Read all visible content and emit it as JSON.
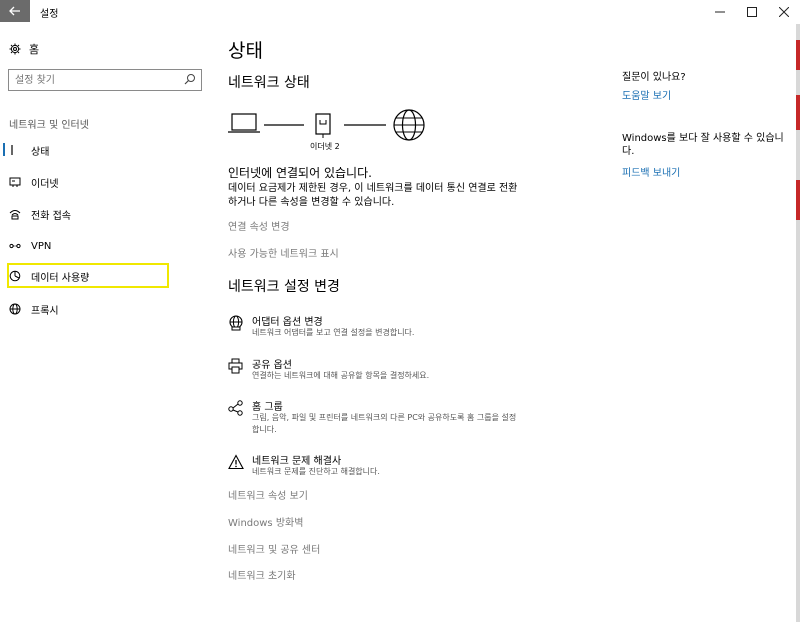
{
  "window": {
    "title": "설정",
    "back_icon": "back-arrow-icon",
    "minimize_glyph": "—",
    "maximize_glyph": "☐",
    "close_glyph": "✕"
  },
  "sidebar": {
    "home_label": "홈",
    "search_placeholder": "설정 찾기",
    "section_heading": "네트워크 및 인터넷",
    "items": [
      {
        "label": "상태",
        "icon": "status-icon"
      },
      {
        "label": "이더넷",
        "icon": "ethernet-icon"
      },
      {
        "label": "전화 접속",
        "icon": "dialup-icon"
      },
      {
        "label": "VPN",
        "icon": "vpn-icon"
      },
      {
        "label": "데이터 사용량",
        "icon": "data-usage-icon"
      },
      {
        "label": "프록시",
        "icon": "globe-icon"
      }
    ],
    "active_color": "#1a6fb3",
    "highlight_color": "#f0e800"
  },
  "main": {
    "page_title": "상태",
    "network_status_title": "네트워크 상태",
    "diagram_label": "이더넷 2",
    "status_main": "인터넷에 연결되어 있습니다.",
    "status_desc": "데이터 요금제가 제한된 경우, 이 네트워크를 데이터 통신 연결로 전환하거나 다른 속성을 변경할 수 있습니다.",
    "link_connection_props": "연결 속성 변경",
    "link_available_networks": "사용 가능한 네트워크 표시",
    "change_settings_title": "네트워크 설정 변경",
    "settings": [
      {
        "title": "어댑터 옵션 변경",
        "desc": "네트워크 어댑터를 보고 연결 설정을 변경합니다.",
        "icon": "adapter-icon"
      },
      {
        "title": "공유 옵션",
        "desc": "연결하는 네트워크에 대해 공유할 항목을 결정하세요.",
        "icon": "sharing-printer-icon"
      },
      {
        "title": "홈 그룹",
        "desc": "그림, 음악, 파일 및 프린터를 네트워크의 다른 PC와 공유하도록 홈 그룹을 설정합니다.",
        "icon": "homegroup-icon"
      },
      {
        "title": "네트워크 문제 해결사",
        "desc": "네트워크 문제를 진단하고 해결합니다.",
        "icon": "warning-icon"
      }
    ],
    "bottom_links": [
      "네트워크 속성 보기",
      "Windows 방화벽",
      "네트워크 및 공유 센터",
      "네트워크 초기화"
    ]
  },
  "help": {
    "question_heading": "질문이 있나요?",
    "help_link": "도움말 보기",
    "improve_heading": "Windows를 보다 잘 사용할 수 있습니다.",
    "feedback_link": "피드백 보내기",
    "link_color": "#1a6fb3"
  }
}
